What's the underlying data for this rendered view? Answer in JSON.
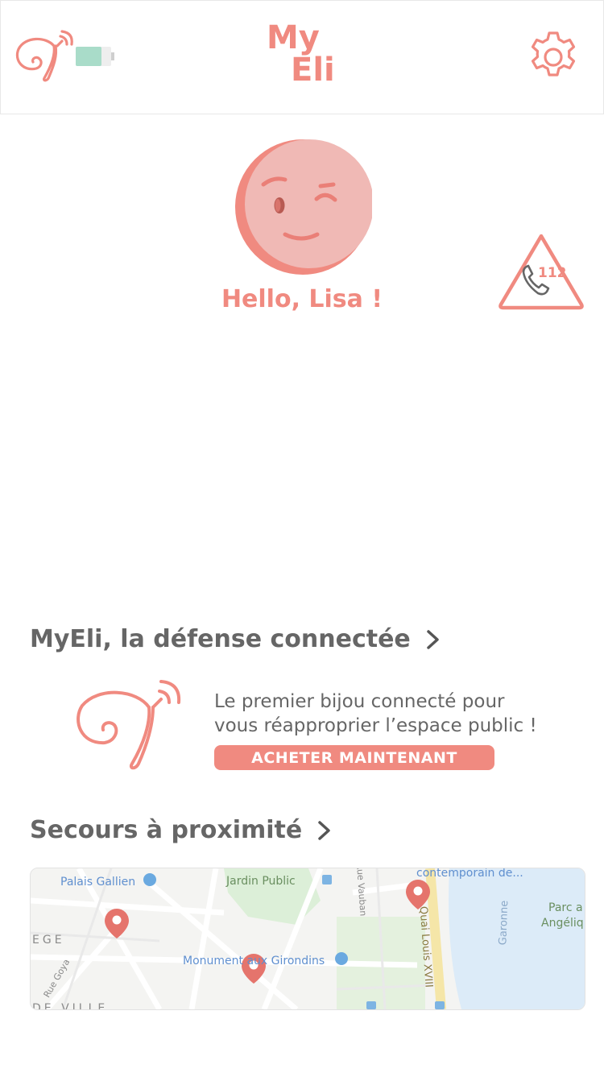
{
  "header": {
    "device_icon": "connected-jewel-icon",
    "battery_icon": "battery-icon",
    "logo_line1": "My",
    "logo_line2": "Eli",
    "settings_icon": "gear-icon"
  },
  "profile": {
    "avatar_icon": "winking-face-icon",
    "greeting": "Hello, Lisa !"
  },
  "emergency": {
    "icon": "emergency-call-icon",
    "number": "112"
  },
  "promo": {
    "section_title": "MyEli, la défense connectée",
    "text_line1": "Le premier bijou connecté pour",
    "text_line2": "vous réapproprier l’espace public !",
    "button_label": "ACHETER MAINTENANT"
  },
  "nearby": {
    "section_title": "Secours à proximité",
    "map": {
      "labels": {
        "palais": "Palais Gallien",
        "jardin": "Jardin Public",
        "contemporain": "contemporain de...",
        "monument": "Monument aux Girondins",
        "quai": "Quai Louis XVIII",
        "garonne": "Garonne",
        "parc": "Parc a",
        "angelique": "Angéliq",
        "vauban": "Rue Vauban",
        "goya": "Rue Goya",
        "ege": "EGE",
        "ville": "DE VILLE"
      }
    }
  },
  "colors": {
    "accent": "#f08a80",
    "text_gray": "#666666",
    "battery": "#a9dcc9"
  }
}
